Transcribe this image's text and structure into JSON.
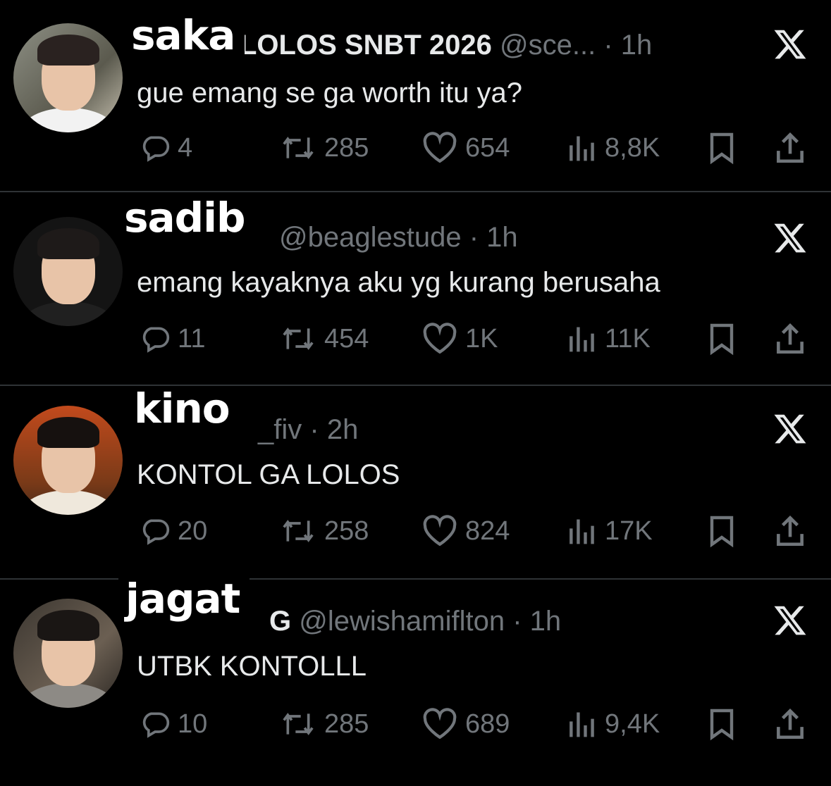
{
  "tweets": [
    {
      "nickname": "saka",
      "display_name": "LOLOS SNBT 2026",
      "handle": "@sce...",
      "sep": "·",
      "time": "1h",
      "text": "gue emang se ga worth itu ya?",
      "replies": "4",
      "retweets": "285",
      "likes": "654",
      "views": "8,8K"
    },
    {
      "nickname": "sadib",
      "display_name": "",
      "handle": "@beaglestude",
      "sep": "·",
      "time": "1h",
      "text": "emang kayaknya aku yg kurang berusaha",
      "replies": "11",
      "retweets": "454",
      "likes": "1K",
      "views": "11K"
    },
    {
      "nickname": "kino",
      "display_name": "",
      "handle": "_fiv",
      "sep": "·",
      "time": "2h",
      "text": "KONTOL GA LOLOS",
      "replies": "20",
      "retweets": "258",
      "likes": "824",
      "views": "17K"
    },
    {
      "nickname": "jagat",
      "display_name": "G",
      "handle": "@lewishamiflton",
      "sep": "·",
      "time": "1h",
      "text": "UTBK KONTOLLL",
      "replies": "10",
      "retweets": "285",
      "likes": "689",
      "views": "9,4K"
    }
  ],
  "icons": {
    "reply": "reply-icon",
    "retweet": "retweet-icon",
    "like": "heart-icon",
    "views": "views-icon",
    "bookmark": "bookmark-icon",
    "share": "share-icon",
    "x": "x-logo-icon"
  },
  "colors": {
    "background": "#000000",
    "text": "#e7e9ea",
    "muted": "#71767b",
    "divider": "#2f3336"
  }
}
